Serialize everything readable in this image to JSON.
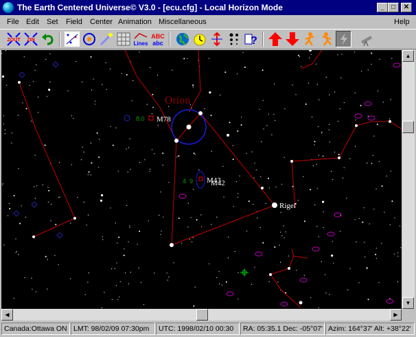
{
  "window": {
    "title": "The Earth Centered Universe© V3.0 - [ecu.cfg] - Local Horizon Mode",
    "minimize_glyph": "_",
    "maximize_glyph": "□",
    "close_glyph": "✕"
  },
  "menu": [
    "File",
    "Edit",
    "Set",
    "Field",
    "Center",
    "Animation",
    "Miscellaneous",
    "Help"
  ],
  "toolbar": {
    "zoom_out": "ZOUT",
    "zoom_in": "ZIN",
    "lines_label": "Lines",
    "abc_label": "ABC",
    "abc_lower": "abc"
  },
  "sky": {
    "constellation_label": "Orion",
    "objects": {
      "m78": {
        "label": "M78",
        "magnitude": "8.0"
      },
      "m42": {
        "label": "M42",
        "magnitude": "4"
      },
      "m43": {
        "label": "M43",
        "magnitude": "9"
      },
      "rigel": {
        "label": "Rigel"
      }
    },
    "colors": {
      "background": "#000000",
      "constellation_lines": "#c80000",
      "constellation_name": "#8b0000",
      "nebula_circle": "#1c1ce0",
      "galaxy_ellipse": "#c000c0",
      "magnitude_text": "#00a000",
      "object_label": "#ffffff"
    }
  },
  "status": {
    "location": "Canada:Ottawa ON",
    "lmt": "LMT: 98/02/09 07:30pm",
    "utc": "UTC: 1998/02/10 00:30",
    "radec": "RA: 05:35.1 Dec: -05°07'",
    "azalt": "Azim: 164°37' Alt: +38°22'"
  }
}
